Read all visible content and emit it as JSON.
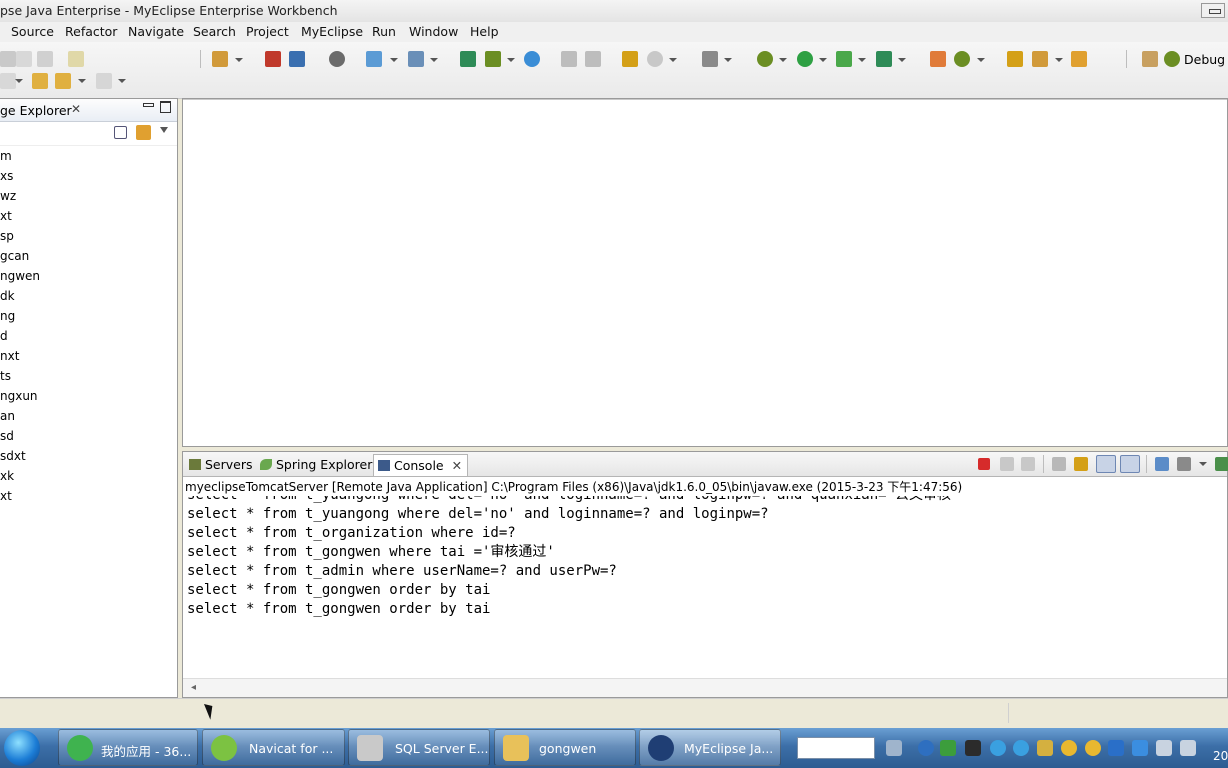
{
  "window": {
    "title": "pse Java Enterprise - MyEclipse Enterprise Workbench"
  },
  "menu": [
    "Source",
    "Refactor",
    "Navigate",
    "Search",
    "Project",
    "MyEclipse",
    "Run",
    "Window",
    "Help"
  ],
  "perspective": {
    "label": "Debug"
  },
  "package_explorer": {
    "title": "ge Explorer",
    "close_glyph": "✕",
    "items": [
      "m",
      "xs",
      "wz",
      "xt",
      "sp",
      "gcan",
      "ngwen",
      "dk",
      "ng",
      "d",
      "nxt",
      "ts",
      "ngxun",
      "an",
      "sd",
      "sdxt",
      "xk",
      "xt"
    ]
  },
  "console": {
    "tabs": [
      {
        "label": "Servers",
        "icon": "servers-icon",
        "color": "#6b7a3b"
      },
      {
        "label": "Spring Explorer",
        "icon": "spring-leaf-icon",
        "color": "#6aa84f"
      },
      {
        "label": "Console",
        "icon": "console-icon",
        "color": "#3c5a8a",
        "close": "✕"
      }
    ],
    "launch_path": "myeclipseTomcatServer [Remote Java Application] C:\\Program Files (x86)\\Java\\jdk1.6.0_05\\bin\\javaw.exe (2015-3-23 下午1:47:56)",
    "lines": [
      "select * from t_yuangong where del='no' and loginname=? and loginpw=? and quanxian='公文审核'",
      "select * from t_yuangong where del='no' and loginname=? and loginpw=?",
      "select * from t_organization where id=?",
      "select * from t_gongwen where tai ='审核通过'",
      "select * from t_admin where userName=? and userPw=?",
      "select * from t_gongwen order by tai",
      "select * from t_gongwen order by tai"
    ],
    "scroll_arrow": "◂"
  },
  "taskbar": {
    "items": [
      {
        "label": "我的应用 - 36...",
        "icon": "ie-360-icon",
        "color": "#3fb34f"
      },
      {
        "label": "Navicat for ...",
        "icon": "navicat-icon",
        "color": "#7cc242"
      },
      {
        "label": "SQL Server E...",
        "icon": "sql-server-icon",
        "color": "#c9c9c9"
      },
      {
        "label": "gongwen",
        "icon": "folder-icon",
        "color": "#e8c15a"
      },
      {
        "label": "MyEclipse Ja...",
        "icon": "myeclipse-icon",
        "color": "#1f3e74"
      }
    ],
    "clock": "20"
  },
  "colors": {
    "toolbar_icons": [
      "#d19a3a",
      "#6b8e23",
      "#1e90ff",
      "#c0392b",
      "#2e8b57",
      "#8a2be2",
      "#3a6fb0",
      "#d4a017"
    ]
  }
}
